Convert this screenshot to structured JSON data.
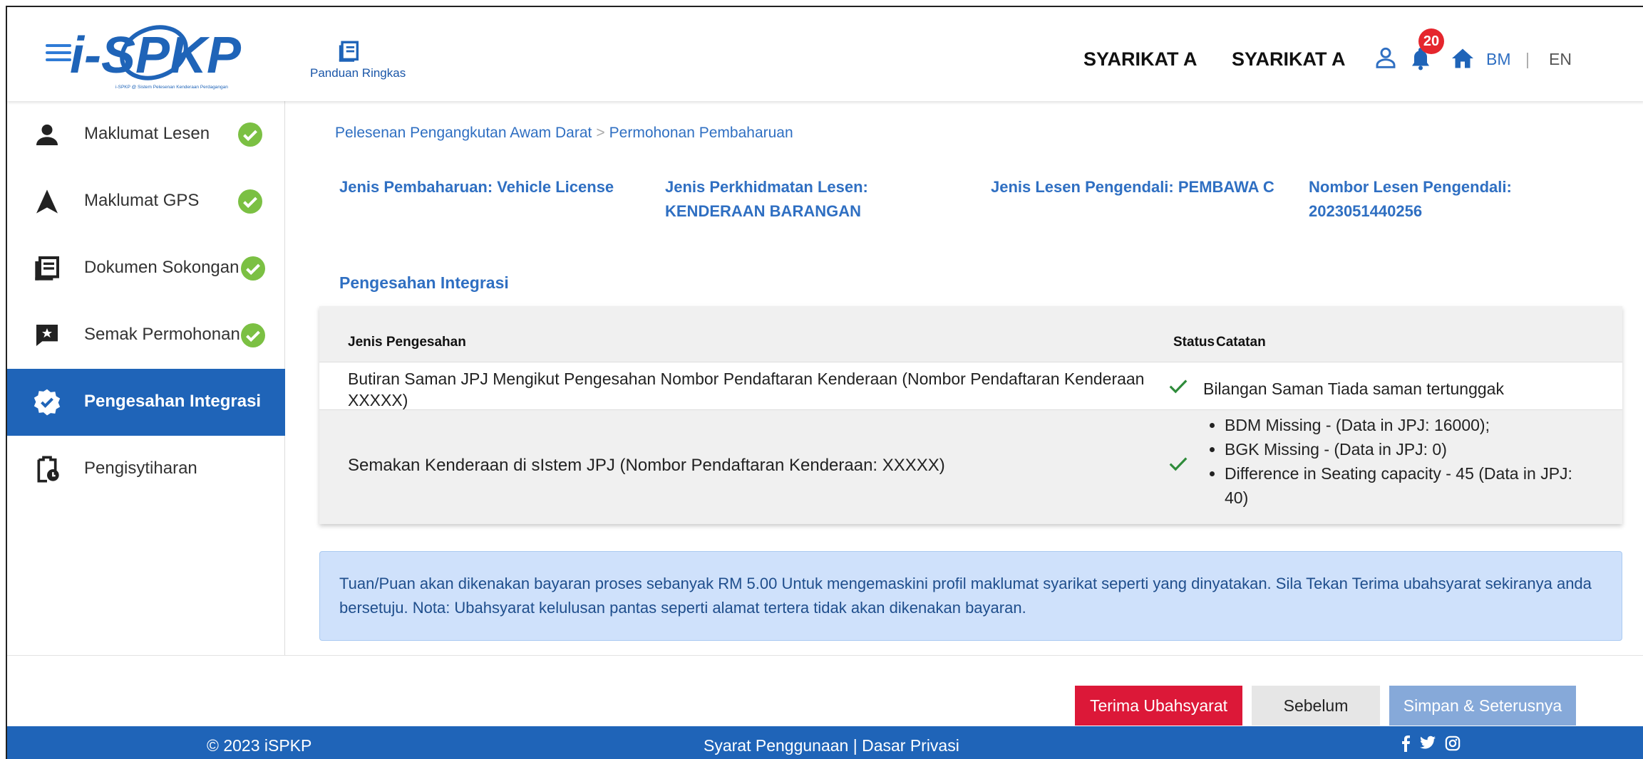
{
  "header": {
    "logo_text": "i-SPKP",
    "logo_tagline": "i-SPKP @ Sistem Pelesenan Kenderaan Perdagangan",
    "guide_label": "Panduan Ringkas",
    "company_name_1": "SYARIKAT A",
    "company_name_2": "SYARIKAT A",
    "notification_count": "20",
    "lang_bm": "BM",
    "lang_separator": "|",
    "lang_en": "EN",
    "icons": [
      "menu-icon",
      "guide-book-icon",
      "user-icon",
      "bell-icon",
      "home-icon"
    ]
  },
  "sidebar": {
    "items": [
      {
        "label": "Maklumat Lesen",
        "icon": "person-icon",
        "completed": true
      },
      {
        "label": "Maklumat GPS",
        "icon": "navigation-arrow-icon",
        "completed": true
      },
      {
        "label": "Dokumen Sokongan",
        "icon": "document-icon",
        "completed": true
      },
      {
        "label": "Semak Permohonan",
        "icon": "review-chat-icon",
        "completed": true
      },
      {
        "label": "Pengesahan Integrasi",
        "icon": "verified-badge-icon",
        "completed": false,
        "active": true
      },
      {
        "label": "Pengisytiharan",
        "icon": "clipboard-clock-icon",
        "completed": false
      }
    ]
  },
  "breadcrumb": {
    "part1": "Pelesenan Pengangkutan Awam Darat",
    "separator": ">",
    "part2": "Permohonan Pembaharuan"
  },
  "info": {
    "renewal_type": "Jenis Pembaharuan: Vehicle License",
    "service_type_line1": "Jenis Perkhidmatan Lesen:",
    "service_type_line2": "KENDERAAN BARANGAN",
    "operator_license_type": "Jenis Lesen Pengendali: PEMBAWA C",
    "operator_license_no_line1": "Nombor Lesen Pengendali:",
    "operator_license_no_line2": "2023051440256"
  },
  "section_title": "Pengesahan Integrasi",
  "table": {
    "headers": {
      "type": "Jenis Pengesahan",
      "status": "Status",
      "notes": "Catatan"
    },
    "rows": [
      {
        "type": "Butiran Saman JPJ Mengikut Pengesahan Nombor Pendaftaran Kenderaan (Nombor Pendaftaran Kenderaan XXXXX)",
        "status": "ok",
        "notes": "Bilangan Saman Tiada saman tertunggak"
      },
      {
        "type": "Semakan Kenderaan di sIstem JPJ (Nombor Pendaftaran Kenderaan: XXXXX)",
        "status": "ok",
        "notes_list": [
          "BDM Missing - (Data in JPJ: 16000);",
          "BGK Missing - (Data in JPJ: 0)",
          "Difference in Seating capacity - 45 (Data in JPJ: 40)"
        ]
      }
    ]
  },
  "notice": "Tuan/Puan akan dikenakan bayaran proses sebanyak RM 5.00 Untuk mengemaskini profil maklumat syarikat seperti yang dinyatakan. Sila Tekan Terima ubahsyarat sekiranya anda bersetuju. Nota: Ubahsyarat kelulusan pantas seperti alamat tertera tidak akan dikenakan bayaran.",
  "actions": {
    "accept": "Terima Ubahsyarat",
    "previous": "Sebelum",
    "save_next": "Simpan & Seterusnya"
  },
  "footer": {
    "copyright": "© 2023 iSPKP",
    "links": "Syarat Penggunaan | Dasar Privasi",
    "social_icons": [
      "facebook-icon",
      "twitter-icon",
      "instagram-icon"
    ]
  },
  "colors": {
    "primary": "#1f64b8",
    "link": "#2f6fc2",
    "success": "#7bc043",
    "danger": "#dc1838",
    "badge": "#e5262d",
    "notice_bg": "#cfe1fb"
  }
}
